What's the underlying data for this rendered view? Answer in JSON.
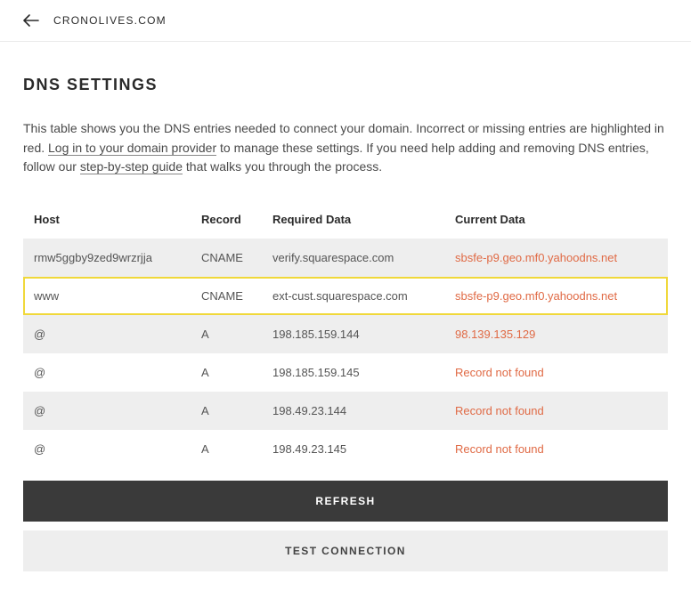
{
  "header": {
    "domain": "CRONOLIVES.COM"
  },
  "title": "DNS SETTINGS",
  "intro": {
    "text_a": "This table shows you the DNS entries needed to connect your domain. Incorrect or missing entries are highlighted in red. ",
    "link1": "Log in to your domain provider",
    "text_b": " to manage these settings. If you need help adding and removing DNS entries, follow our ",
    "link2": "step-by-step guide",
    "text_c": " that walks you through the process."
  },
  "columns": {
    "host": "Host",
    "record": "Record",
    "required": "Required Data",
    "current": "Current Data"
  },
  "rows": [
    {
      "host": "rmw5ggby9zed9wrzrjja",
      "record": "CNAME",
      "required": "verify.squarespace.com",
      "current": "sbsfe-p9.geo.mf0.yahoodns.net",
      "error": true,
      "highlight": false
    },
    {
      "host": "www",
      "record": "CNAME",
      "required": "ext-cust.squarespace.com",
      "current": "sbsfe-p9.geo.mf0.yahoodns.net",
      "error": true,
      "highlight": true
    },
    {
      "host": "@",
      "record": "A",
      "required": "198.185.159.144",
      "current": "98.139.135.129",
      "error": true,
      "highlight": false
    },
    {
      "host": "@",
      "record": "A",
      "required": "198.185.159.145",
      "current": "Record not found",
      "error": true,
      "highlight": false
    },
    {
      "host": "@",
      "record": "A",
      "required": "198.49.23.144",
      "current": "Record not found",
      "error": true,
      "highlight": false
    },
    {
      "host": "@",
      "record": "A",
      "required": "198.49.23.145",
      "current": "Record not found",
      "error": true,
      "highlight": false
    }
  ],
  "buttons": {
    "refresh": "REFRESH",
    "test": "TEST CONNECTION"
  }
}
